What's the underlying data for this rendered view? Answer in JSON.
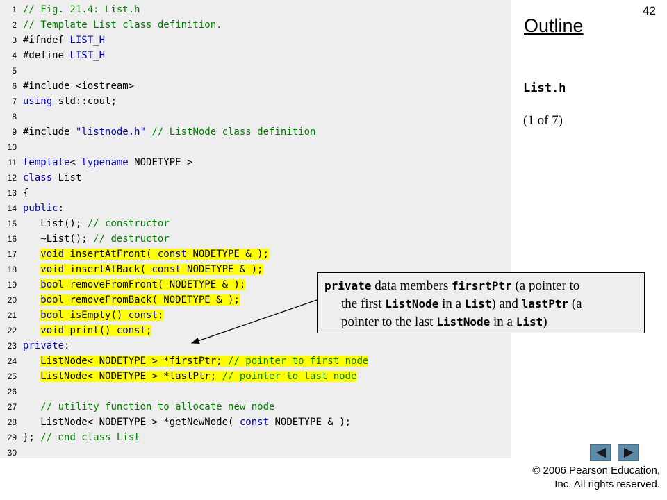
{
  "slide_number": "42",
  "outline_title": "Outline",
  "file_name": "List.h",
  "page_indicator": "(1 of 7)",
  "code": [
    {
      "n": "1",
      "hl": false,
      "tokens": [
        {
          "t": "// Fig. 21.4: List.h",
          "c": "cm"
        }
      ]
    },
    {
      "n": "2",
      "hl": false,
      "tokens": [
        {
          "t": "// Template List class definition.",
          "c": "cm"
        }
      ]
    },
    {
      "n": "3",
      "hl": false,
      "tokens": [
        {
          "t": "#ifndef",
          "c": "tx"
        },
        {
          "t": " LIST_H",
          "c": "pp"
        }
      ]
    },
    {
      "n": "4",
      "hl": false,
      "tokens": [
        {
          "t": "#define",
          "c": "tx"
        },
        {
          "t": " LIST_H",
          "c": "pp"
        }
      ]
    },
    {
      "n": "5",
      "hl": false,
      "tokens": []
    },
    {
      "n": "6",
      "hl": false,
      "tokens": [
        {
          "t": "#include",
          "c": "tx"
        },
        {
          "t": " <iostream>",
          "c": "tx"
        }
      ]
    },
    {
      "n": "7",
      "hl": false,
      "tokens": [
        {
          "t": "using",
          "c": "kw"
        },
        {
          "t": " std::cout;",
          "c": "tx"
        }
      ]
    },
    {
      "n": "8",
      "hl": false,
      "tokens": []
    },
    {
      "n": "9",
      "hl": false,
      "tokens": [
        {
          "t": "#include",
          "c": "tx"
        },
        {
          "t": " \"listnode.h\"",
          "c": "st"
        },
        {
          "t": " // ListNode class definition",
          "c": "cm"
        }
      ]
    },
    {
      "n": "10",
      "hl": false,
      "tokens": []
    },
    {
      "n": "11",
      "hl": false,
      "tokens": [
        {
          "t": "template",
          "c": "kw"
        },
        {
          "t": "< ",
          "c": "tx"
        },
        {
          "t": "typename",
          "c": "kw"
        },
        {
          "t": " NODETYPE >",
          "c": "tx"
        }
      ]
    },
    {
      "n": "12",
      "hl": false,
      "tokens": [
        {
          "t": "class",
          "c": "kw"
        },
        {
          "t": " List",
          "c": "tx"
        }
      ]
    },
    {
      "n": "13",
      "hl": false,
      "tokens": [
        {
          "t": "{",
          "c": "tx"
        }
      ]
    },
    {
      "n": "14",
      "hl": false,
      "tokens": [
        {
          "t": "public",
          "c": "kw"
        },
        {
          "t": ":",
          "c": "tx"
        }
      ]
    },
    {
      "n": "15",
      "hl": false,
      "tokens": [
        {
          "t": "   List(); ",
          "c": "tx"
        },
        {
          "t": "// constructor",
          "c": "cm"
        }
      ]
    },
    {
      "n": "16",
      "hl": false,
      "tokens": [
        {
          "t": "   ~List(); ",
          "c": "tx"
        },
        {
          "t": "// destructor",
          "c": "cm"
        }
      ]
    },
    {
      "n": "17",
      "hl": true,
      "tokens": [
        {
          "t": "void",
          "c": "kw"
        },
        {
          "t": " insertAtFront( ",
          "c": "tx"
        },
        {
          "t": "const",
          "c": "kw"
        },
        {
          "t": " NODETYPE & );",
          "c": "tx"
        }
      ]
    },
    {
      "n": "18",
      "hl": true,
      "tokens": [
        {
          "t": "void",
          "c": "kw"
        },
        {
          "t": " insertAtBack( ",
          "c": "tx"
        },
        {
          "t": "const",
          "c": "kw"
        },
        {
          "t": " NODETYPE & );",
          "c": "tx"
        }
      ]
    },
    {
      "n": "19",
      "hl": true,
      "tokens": [
        {
          "t": "bool",
          "c": "kw"
        },
        {
          "t": " removeFromFront( NODETYPE & );",
          "c": "tx"
        }
      ]
    },
    {
      "n": "20",
      "hl": true,
      "tokens": [
        {
          "t": "bool",
          "c": "kw"
        },
        {
          "t": " removeFromBack( NODETYPE & );",
          "c": "tx"
        }
      ]
    },
    {
      "n": "21",
      "hl": true,
      "tokens": [
        {
          "t": "bool",
          "c": "kw"
        },
        {
          "t": " isEmpty() ",
          "c": "tx"
        },
        {
          "t": "const",
          "c": "kw"
        },
        {
          "t": ";",
          "c": "tx"
        }
      ]
    },
    {
      "n": "22",
      "hl": true,
      "tokens": [
        {
          "t": "void",
          "c": "kw"
        },
        {
          "t": " print() ",
          "c": "tx"
        },
        {
          "t": "const",
          "c": "kw"
        },
        {
          "t": ";",
          "c": "tx"
        }
      ]
    },
    {
      "n": "23",
      "hl": false,
      "tokens": [
        {
          "t": "private",
          "c": "kw"
        },
        {
          "t": ":",
          "c": "tx"
        }
      ]
    },
    {
      "n": "24",
      "hl": true,
      "tokens": [
        {
          "t": "ListNode< NODETYPE > *firstPtr; ",
          "c": "tx"
        },
        {
          "t": "// pointer to first node",
          "c": "cm"
        }
      ]
    },
    {
      "n": "25",
      "hl": true,
      "tokens": [
        {
          "t": "ListNode< NODETYPE > *lastPtr; ",
          "c": "tx"
        },
        {
          "t": "// pointer to last node",
          "c": "cm"
        }
      ]
    },
    {
      "n": "26",
      "hl": false,
      "tokens": []
    },
    {
      "n": "27",
      "hl": false,
      "tokens": [
        {
          "t": "   ",
          "c": "tx"
        },
        {
          "t": "// utility function to allocate new node",
          "c": "cm"
        }
      ]
    },
    {
      "n": "28",
      "hl": false,
      "tokens": [
        {
          "t": "   ListNode< NODETYPE > *getNewNode( ",
          "c": "tx"
        },
        {
          "t": "const",
          "c": "kw"
        },
        {
          "t": " NODETYPE & );",
          "c": "tx"
        }
      ]
    },
    {
      "n": "29",
      "hl": false,
      "tokens": [
        {
          "t": "}; ",
          "c": "tx"
        },
        {
          "t": "// end class List",
          "c": "cm"
        }
      ]
    },
    {
      "n": "30",
      "hl": false,
      "tokens": []
    }
  ],
  "callout": {
    "kw_private": "private",
    "t1": " data members ",
    "firsrtPtr": "firsrtPtr",
    "t2": " (a pointer to",
    "t3": "the first ",
    "listnode1": "ListNode",
    "t4": " in a ",
    "list1": "List",
    "t5": ") and ",
    "lastPtr": "lastPtr",
    "t6": " (a",
    "t7": "pointer to the last ",
    "listnode2": "ListNode",
    "t8": " in a ",
    "list2": "List",
    "t9": ")"
  },
  "nav": {
    "prev_icon": "triangle-left-icon",
    "next_icon": "triangle-right-icon"
  },
  "copyright_line1": "© 2006 Pearson Education,",
  "copyright_line2": "Inc.  All rights reserved.",
  "colors": {
    "keyword": "#0000cc",
    "comment": "#008000",
    "highlight": "#ffff00",
    "panel": "#eeeeee",
    "nav_button": "#5b8ba8"
  }
}
